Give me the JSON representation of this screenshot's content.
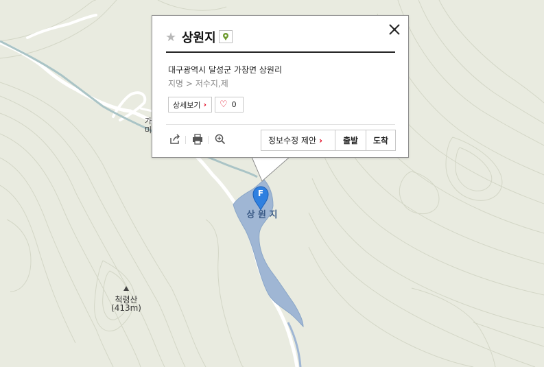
{
  "place": {
    "name": "상원지",
    "address": "대구광역시 달성군 가창면 상원리",
    "category_root": "지명",
    "category_sep": ">",
    "category_leaf": "저수지,제",
    "like_count": "0"
  },
  "buttons": {
    "detail": "상세보기",
    "suggest_edit": "정보수정 제안",
    "start": "출발",
    "end": "도착"
  },
  "map": {
    "reservoir_label": "상 원 지",
    "marker_letter": "F",
    "mountain_name": "척령산",
    "mountain_height": "(413m)",
    "partial_label_1": "가",
    "partial_label_2": "미"
  },
  "colors": {
    "land": "#e9ebe0",
    "contour": "#d3d6c6",
    "water": "#9fb6d4",
    "marker": "#2f80e0",
    "accent_red": "#e0001b"
  },
  "icons": [
    "star-icon",
    "category-pin-icon",
    "close-icon",
    "chevron-right-icon",
    "heart-icon",
    "share-icon",
    "print-icon",
    "zoom-in-icon",
    "location-marker-icon",
    "mountain-peak-icon"
  ]
}
